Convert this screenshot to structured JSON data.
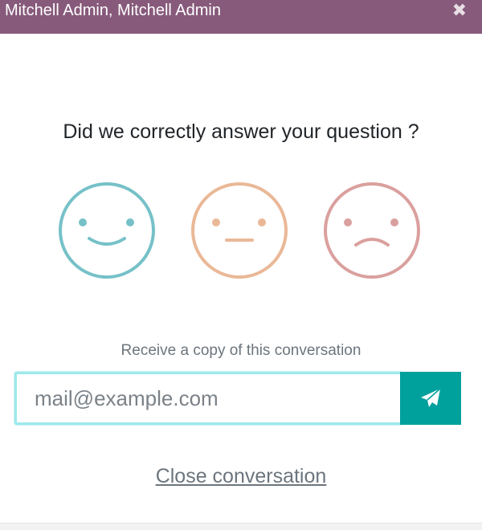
{
  "header": {
    "title": "Mitchell Admin, Mitchell Admin",
    "close_glyph": "✖",
    "background": "#875a7b"
  },
  "rating": {
    "question": "Did we correctly answer your question ?",
    "options": [
      {
        "icon": "happy-face-icon",
        "color": "#76c1c8"
      },
      {
        "icon": "neutral-face-icon",
        "color": "#eab897"
      },
      {
        "icon": "sad-face-icon",
        "color": "#daa09e"
      }
    ]
  },
  "transcript": {
    "label": "Receive a copy of this conversation",
    "email_placeholder": "mail@example.com",
    "email_value": "",
    "send_icon": "paper-plane-icon",
    "send_color": "#00a09d"
  },
  "footer": {
    "close_link": "Close conversation"
  }
}
